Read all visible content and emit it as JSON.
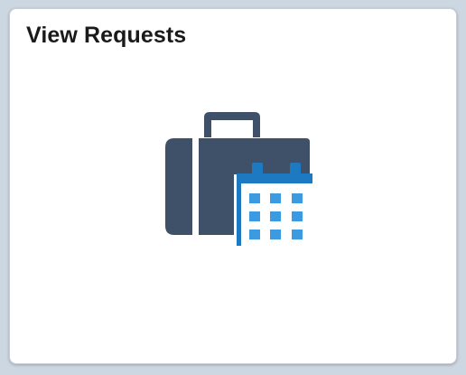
{
  "tile": {
    "title": "View Requests",
    "icon": "briefcase-calendar-icon"
  },
  "colors": {
    "briefcase": "#3f5168",
    "calendar_border": "#1d7ac2",
    "calendar_cell": "#3b9ae0",
    "tile_background": "#ffffff",
    "page_background": "#cdd7e1"
  }
}
